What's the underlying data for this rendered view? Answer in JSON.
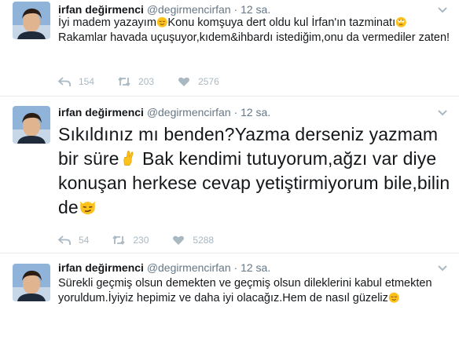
{
  "tweets": [
    {
      "name": "irfan değirmenci",
      "handle": "@degirmencirfan",
      "dot": "·",
      "time": "12 sa.",
      "text_parts": [
        "İyi madem yazayım",
        "Konu komşuya dert oldu kul İrfan'ın tazminatı",
        "Rakamlar havada uçuşuyor,kıdem&ihbardı istediğim,onu da vermediler zaten!"
      ],
      "emojis": [
        "relieved-face-emoji",
        "rolling-eyes-emoji"
      ],
      "replies": "154",
      "retweets": "203",
      "likes": "2576"
    },
    {
      "name": "irfan değirmenci",
      "handle": "@degirmencirfan",
      "dot": "·",
      "time": "12 sa.",
      "text_parts": [
        "Sıkıldınız mı benden?Yazma derseniz yazmam bir süre",
        "Bak kendimi tutuyorum,ağzı var diye konuşan herkese cevap yetiştirmiyorum bile,bilin de"
      ],
      "emojis": [
        "crossed-fingers-emoji",
        "smirking-cat-emoji"
      ],
      "replies": "54",
      "retweets": "230",
      "likes": "5288"
    },
    {
      "name": "irfan değirmenci",
      "handle": "@degirmencirfan",
      "dot": "·",
      "time": "12 sa.",
      "text_parts": [
        "Sürekli geçmiş olsun demekten ve geçmiş olsun dileklerini kabul etmekten yoruldum.İyiyiz hepimiz ve daha iyi olacağız.Hem de nasıl güzeliz"
      ],
      "emojis": [
        "relieved-face-emoji"
      ]
    }
  ],
  "colors": {
    "text": "#14171a",
    "muted": "#657786",
    "icon": "#aab8c2",
    "divider": "#e6ecf0",
    "emoji": "#fcc21b"
  }
}
